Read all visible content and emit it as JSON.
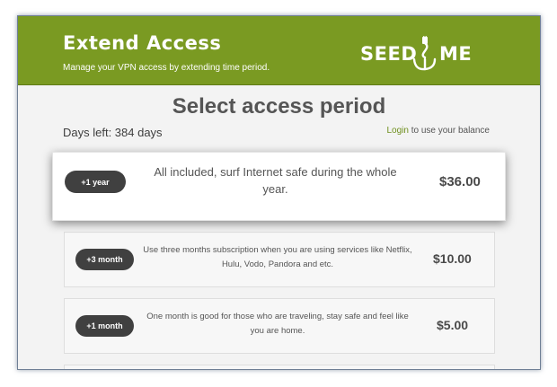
{
  "header": {
    "title": "Extend Access",
    "subtitle": "Manage your VPN access by extending time period.",
    "logo_left": "SEED",
    "logo_right": "ME",
    "colors": {
      "brand_green": "#7a9a22",
      "pill_dark": "#404040"
    }
  },
  "main": {
    "title": "Select access period",
    "days_left": "Days left: 384 days",
    "login_link": "Login",
    "login_suffix": " to use your balance"
  },
  "plans": [
    {
      "label": "+1 year",
      "description": "All included, surf Internet safe during the whole year.",
      "price": "$36.00"
    },
    {
      "label": "+3 month",
      "description": "Use three months subscription when you are using services like Netflix, Hulu, Vodo, Pandora and etc.",
      "price": "$10.00"
    },
    {
      "label": "+1 month",
      "description": "One month is good for those who are traveling, stay safe and feel like you are home.",
      "price": "$5.00"
    }
  ]
}
